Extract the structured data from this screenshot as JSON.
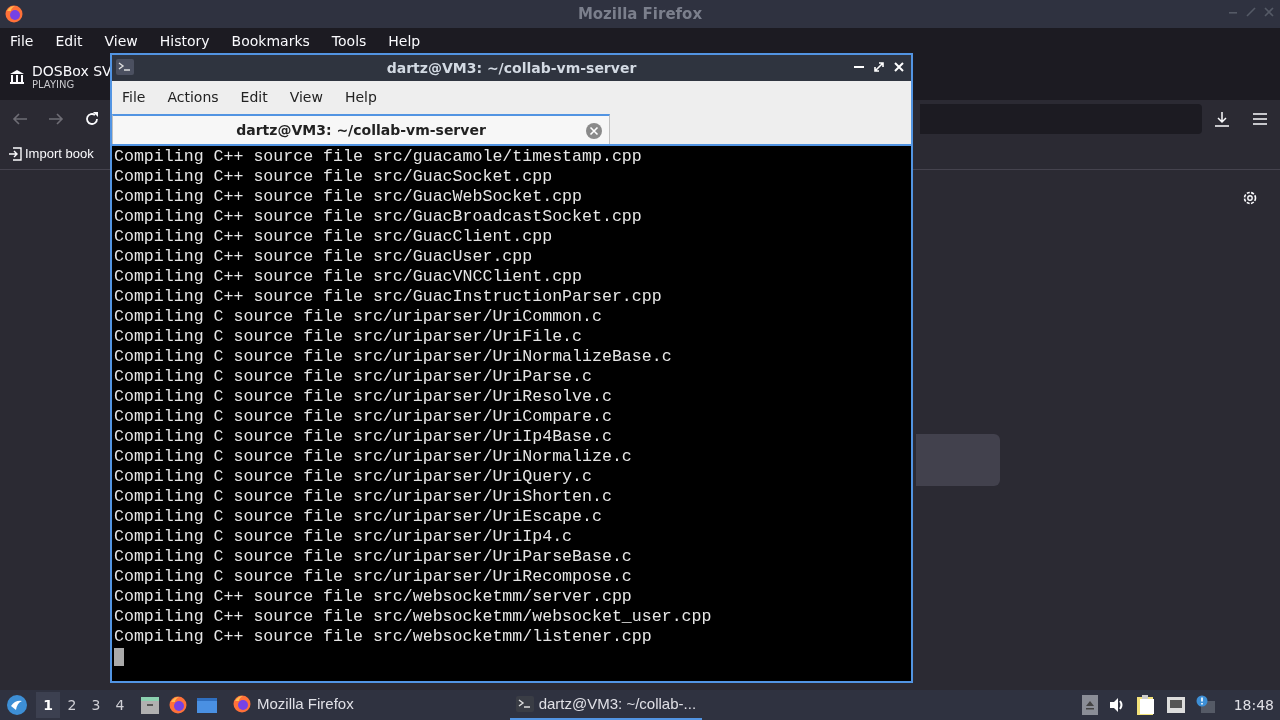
{
  "firefox": {
    "title": "Mozilla Firefox",
    "menu": [
      "File",
      "Edit",
      "View",
      "History",
      "Bookmarks",
      "Tools",
      "Help"
    ],
    "tab": {
      "title": "DOSBox SV",
      "status": "PLAYING"
    },
    "bookmarks": [
      "Import book"
    ]
  },
  "terminal": {
    "title": "dartz@VM3: ~/collab-vm-server",
    "menu": [
      "File",
      "Actions",
      "Edit",
      "View",
      "Help"
    ],
    "tabs": [
      {
        "label": "dartz@VM3: ~/collab-vm-server",
        "selected": true
      }
    ],
    "lines": [
      "Compiling C++ source file src/guacamole/timestamp.cpp",
      "Compiling C++ source file src/GuacSocket.cpp",
      "Compiling C++ source file src/GuacWebSocket.cpp",
      "Compiling C++ source file src/GuacBroadcastSocket.cpp",
      "Compiling C++ source file src/GuacClient.cpp",
      "Compiling C++ source file src/GuacUser.cpp",
      "Compiling C++ source file src/GuacVNCClient.cpp",
      "Compiling C++ source file src/GuacInstructionParser.cpp",
      "Compiling C source file src/uriparser/UriCommon.c",
      "Compiling C source file src/uriparser/UriFile.c",
      "Compiling C source file src/uriparser/UriNormalizeBase.c",
      "Compiling C source file src/uriparser/UriParse.c",
      "Compiling C source file src/uriparser/UriResolve.c",
      "Compiling C source file src/uriparser/UriCompare.c",
      "Compiling C source file src/uriparser/UriIp4Base.c",
      "Compiling C source file src/uriparser/UriNormalize.c",
      "Compiling C source file src/uriparser/UriQuery.c",
      "Compiling C source file src/uriparser/UriShorten.c",
      "Compiling C source file src/uriparser/UriEscape.c",
      "Compiling C source file src/uriparser/UriIp4.c",
      "Compiling C source file src/uriparser/UriParseBase.c",
      "Compiling C source file src/uriparser/UriRecompose.c",
      "Compiling C++ source file src/websocketmm/server.cpp",
      "Compiling C++ source file src/websocketmm/websocket_user.cpp",
      "Compiling C++ source file src/websocketmm/listener.cpp"
    ]
  },
  "taskbar": {
    "workspaces": [
      {
        "label": "1",
        "selected": true
      },
      {
        "label": "2",
        "selected": false
      },
      {
        "label": "3",
        "selected": false
      },
      {
        "label": "4",
        "selected": false
      }
    ],
    "tasks": [
      {
        "label": "Mozilla Firefox",
        "kind": "firefox",
        "selected": false
      },
      {
        "label": "dartz@VM3: ~/collab-...",
        "kind": "terminal",
        "selected": true
      }
    ],
    "clock": "18:48"
  }
}
